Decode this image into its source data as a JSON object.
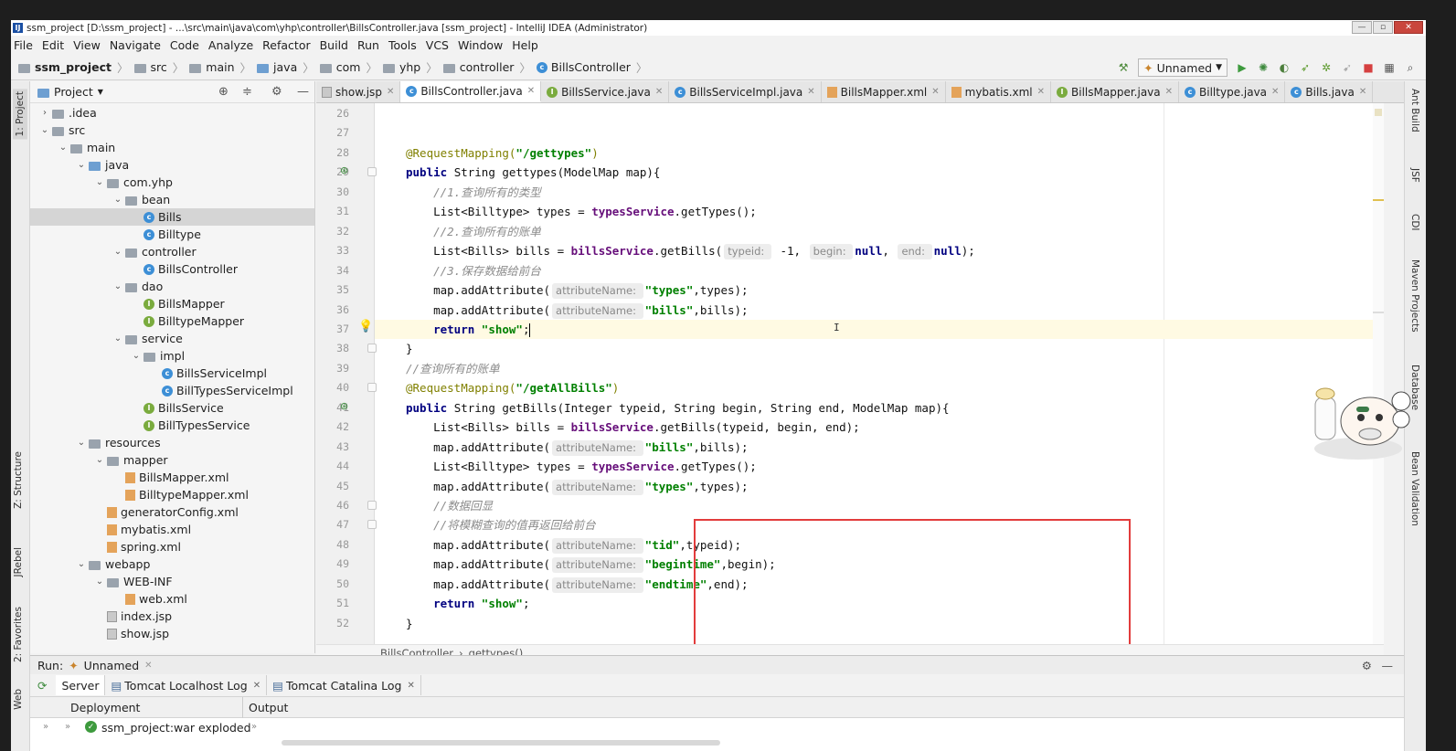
{
  "window": {
    "title": "ssm_project [D:\\ssm_project] - ...\\src\\main\\java\\com\\yhp\\controller\\BillsController.java [ssm_project] - IntelliJ IDEA (Administrator)"
  },
  "menu": [
    "File",
    "Edit",
    "View",
    "Navigate",
    "Code",
    "Analyze",
    "Refactor",
    "Build",
    "Run",
    "Tools",
    "VCS",
    "Window",
    "Help"
  ],
  "breadcrumb": [
    "ssm_project",
    "src",
    "main",
    "java",
    "com",
    "yhp",
    "controller",
    "BillsController"
  ],
  "run_config": "Unnamed",
  "left_tools": {
    "project": "1: Project",
    "structure": "Z: Structure",
    "jrebel": "JRebel",
    "favorites": "2: Favorites",
    "web": "Web"
  },
  "right_tools": [
    "Ant Build",
    "JSF",
    "CDI",
    "Maven Projects",
    "Database",
    "Bean Validation"
  ],
  "project_panel": {
    "title": "Project",
    "tree": [
      {
        "label": ".idea",
        "depth": 1,
        "icon": "folder",
        "arrow": ">"
      },
      {
        "label": "src",
        "depth": 1,
        "icon": "folder",
        "arrow": "v"
      },
      {
        "label": "main",
        "depth": 2,
        "icon": "folder",
        "arrow": "v"
      },
      {
        "label": "java",
        "depth": 3,
        "icon": "folder-blue",
        "arrow": "v"
      },
      {
        "label": "com.yhp",
        "depth": 4,
        "icon": "package",
        "arrow": "v"
      },
      {
        "label": "bean",
        "depth": 5,
        "icon": "package",
        "arrow": "v"
      },
      {
        "label": "Bills",
        "depth": 6,
        "icon": "class",
        "arrow": "",
        "selected": true
      },
      {
        "label": "Billtype",
        "depth": 6,
        "icon": "class",
        "arrow": ""
      },
      {
        "label": "controller",
        "depth": 5,
        "icon": "package",
        "arrow": "v"
      },
      {
        "label": "BillsController",
        "depth": 6,
        "icon": "class",
        "arrow": ""
      },
      {
        "label": "dao",
        "depth": 5,
        "icon": "package",
        "arrow": "v"
      },
      {
        "label": "BillsMapper",
        "depth": 6,
        "icon": "interface",
        "arrow": ""
      },
      {
        "label": "BilltypeMapper",
        "depth": 6,
        "icon": "interface",
        "arrow": ""
      },
      {
        "label": "service",
        "depth": 5,
        "icon": "package",
        "arrow": "v"
      },
      {
        "label": "impl",
        "depth": 6,
        "icon": "package",
        "arrow": "v"
      },
      {
        "label": "BillsServiceImpl",
        "depth": 7,
        "icon": "class",
        "arrow": ""
      },
      {
        "label": "BillTypesServiceImpl",
        "depth": 7,
        "icon": "class",
        "arrow": ""
      },
      {
        "label": "BillsService",
        "depth": 6,
        "icon": "interface",
        "arrow": ""
      },
      {
        "label": "BillTypesService",
        "depth": 6,
        "icon": "interface",
        "arrow": ""
      },
      {
        "label": "resources",
        "depth": 3,
        "icon": "folder",
        "arrow": "v"
      },
      {
        "label": "mapper",
        "depth": 4,
        "icon": "folder",
        "arrow": "v"
      },
      {
        "label": "BillsMapper.xml",
        "depth": 5,
        "icon": "xml",
        "arrow": ""
      },
      {
        "label": "BilltypeMapper.xml",
        "depth": 5,
        "icon": "xml",
        "arrow": ""
      },
      {
        "label": "generatorConfig.xml",
        "depth": 4,
        "icon": "xml",
        "arrow": ""
      },
      {
        "label": "mybatis.xml",
        "depth": 4,
        "icon": "xml",
        "arrow": ""
      },
      {
        "label": "spring.xml",
        "depth": 4,
        "icon": "xml",
        "arrow": ""
      },
      {
        "label": "webapp",
        "depth": 3,
        "icon": "folder",
        "arrow": "v"
      },
      {
        "label": "WEB-INF",
        "depth": 4,
        "icon": "folder",
        "arrow": "v"
      },
      {
        "label": "web.xml",
        "depth": 5,
        "icon": "xml",
        "arrow": ""
      },
      {
        "label": "index.jsp",
        "depth": 4,
        "icon": "jsp",
        "arrow": ""
      },
      {
        "label": "show.jsp",
        "depth": 4,
        "icon": "jsp",
        "arrow": ""
      }
    ]
  },
  "editor_tabs": [
    {
      "label": "show.jsp",
      "icon": "jsp"
    },
    {
      "label": "BillsController.java",
      "icon": "class",
      "active": true
    },
    {
      "label": "BillsService.java",
      "icon": "interface"
    },
    {
      "label": "BillsServiceImpl.java",
      "icon": "class"
    },
    {
      "label": "BillsMapper.xml",
      "icon": "xml"
    },
    {
      "label": "mybatis.xml",
      "icon": "xml"
    },
    {
      "label": "BillsMapper.java",
      "icon": "interface"
    },
    {
      "label": "Billtype.java",
      "icon": "class"
    },
    {
      "label": "Bills.java",
      "icon": "class"
    }
  ],
  "editor": {
    "lines": [
      {
        "n": "26",
        "segs": []
      },
      {
        "n": "27",
        "segs": []
      },
      {
        "n": "28",
        "segs": [
          [
            "ann",
            "@RequestMapping("
          ],
          [
            "str",
            "\"/gettypes\""
          ],
          [
            "ann",
            ")"
          ]
        ]
      },
      {
        "n": "29",
        "segs": [
          [
            "kw",
            "public "
          ],
          [
            "t",
            "String gettypes(ModelMap map){"
          ]
        ]
      },
      {
        "n": "30",
        "segs": [
          [
            "t",
            "    "
          ],
          [
            "cmt",
            "//1.查询所有的类型"
          ]
        ]
      },
      {
        "n": "31",
        "segs": [
          [
            "t",
            "    List<Billtype> types = "
          ],
          [
            "fld",
            "typesService"
          ],
          [
            "t",
            ".getTypes();"
          ]
        ]
      },
      {
        "n": "32",
        "segs": [
          [
            "t",
            "    "
          ],
          [
            "cmt",
            "//2.查询所有的账单"
          ]
        ]
      },
      {
        "n": "33",
        "segs": [
          [
            "t",
            "    List<Bills> bills = "
          ],
          [
            "fld",
            "billsService"
          ],
          [
            "t",
            ".getBills("
          ],
          [
            "hint",
            "typeid: "
          ],
          [
            "t",
            " -1, "
          ],
          [
            "hint",
            "begin: "
          ],
          [
            "kw",
            "null"
          ],
          [
            "t",
            ", "
          ],
          [
            "hint",
            "end: "
          ],
          [
            "kw",
            "null"
          ],
          [
            "t",
            ");"
          ]
        ]
      },
      {
        "n": "34",
        "segs": [
          [
            "t",
            "    "
          ],
          [
            "cmt",
            "//3.保存数据给前台"
          ]
        ]
      },
      {
        "n": "35",
        "segs": [
          [
            "t",
            "    map.addAttribute("
          ],
          [
            "hint",
            "attributeName: "
          ],
          [
            "str",
            "\"types\""
          ],
          [
            "t",
            ",types);"
          ]
        ]
      },
      {
        "n": "36",
        "segs": [
          [
            "t",
            "    map.addAttribute("
          ],
          [
            "hint",
            "attributeName: "
          ],
          [
            "str",
            "\"bills\""
          ],
          [
            "t",
            ",bills);"
          ]
        ]
      },
      {
        "n": "37",
        "segs": [
          [
            "t",
            "    "
          ],
          [
            "kw",
            "return "
          ],
          [
            "str",
            "\"show\""
          ],
          [
            "t",
            ";"
          ]
        ],
        "current": true
      },
      {
        "n": "38",
        "segs": [
          [
            "t",
            "}"
          ]
        ]
      },
      {
        "n": "39",
        "segs": [
          [
            "cmt",
            "//查询所有的账单"
          ]
        ]
      },
      {
        "n": "40",
        "segs": [
          [
            "ann",
            "@RequestMapping("
          ],
          [
            "str",
            "\"/getAllBills\""
          ],
          [
            "ann",
            ")"
          ]
        ]
      },
      {
        "n": "41",
        "segs": [
          [
            "kw",
            "public "
          ],
          [
            "t",
            "String getBills(Integer typeid, String begin, String end, ModelMap map){"
          ]
        ]
      },
      {
        "n": "42",
        "segs": [
          [
            "t",
            "    List<Bills> bills = "
          ],
          [
            "fld",
            "billsService"
          ],
          [
            "t",
            ".getBills(typeid, begin, end);"
          ]
        ]
      },
      {
        "n": "43",
        "segs": [
          [
            "t",
            "    map.addAttribute("
          ],
          [
            "hint",
            "attributeName: "
          ],
          [
            "str",
            "\"bills\""
          ],
          [
            "t",
            ",bills);"
          ]
        ]
      },
      {
        "n": "44",
        "segs": [
          [
            "t",
            "    List<Billtype> types = "
          ],
          [
            "fld",
            "typesService"
          ],
          [
            "t",
            ".getTypes();"
          ]
        ]
      },
      {
        "n": "45",
        "segs": [
          [
            "t",
            "    map.addAttribute("
          ],
          [
            "hint",
            "attributeName: "
          ],
          [
            "str",
            "\"types\""
          ],
          [
            "t",
            ",types);"
          ]
        ]
      },
      {
        "n": "46",
        "segs": [
          [
            "t",
            "    "
          ],
          [
            "cmt",
            "//数据回显"
          ]
        ]
      },
      {
        "n": "47",
        "segs": [
          [
            "t",
            "    "
          ],
          [
            "cmt",
            "//将模糊查询的值再返回给前台"
          ]
        ]
      },
      {
        "n": "48",
        "segs": [
          [
            "t",
            "    map.addAttribute("
          ],
          [
            "hint",
            "attributeName: "
          ],
          [
            "str",
            "\"tid\""
          ],
          [
            "t",
            ",typeid);"
          ]
        ]
      },
      {
        "n": "49",
        "segs": [
          [
            "t",
            "    map.addAttribute("
          ],
          [
            "hint",
            "attributeName: "
          ],
          [
            "str",
            "\"begintime\""
          ],
          [
            "t",
            ",begin);"
          ]
        ]
      },
      {
        "n": "50",
        "segs": [
          [
            "t",
            "    map.addAttribute("
          ],
          [
            "hint",
            "attributeName: "
          ],
          [
            "str",
            "\"endtime\""
          ],
          [
            "t",
            ",end);"
          ]
        ]
      },
      {
        "n": "51",
        "segs": [
          [
            "t",
            "    "
          ],
          [
            "kw",
            "return "
          ],
          [
            "str",
            "\"show\""
          ],
          [
            "t",
            ";"
          ]
        ]
      },
      {
        "n": "52",
        "segs": [
          [
            "t",
            "}"
          ]
        ]
      }
    ],
    "crumbs": [
      "BillsController",
      "gettypes()"
    ]
  },
  "run_panel": {
    "label": "Run:",
    "config": "Unnamed",
    "tabs": [
      "Server",
      "Tomcat Localhost Log",
      "Tomcat Catalina Log"
    ],
    "deployment_header": "Deployment",
    "output_header": "Output",
    "artifact": "ssm_project:war exploded"
  },
  "colors": {
    "highlight_box": "#e23c3c",
    "current_line": "#fffae3"
  }
}
